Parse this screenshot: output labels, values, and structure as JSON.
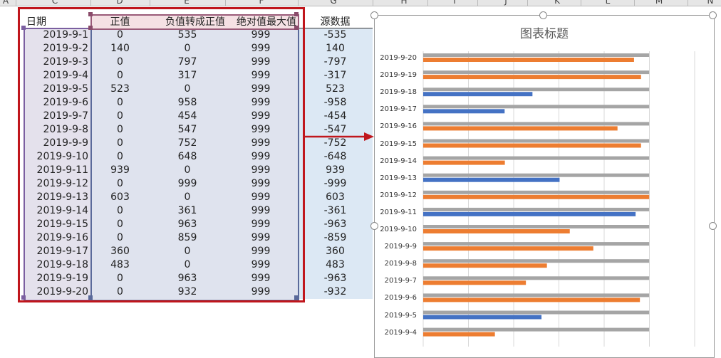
{
  "columns": [
    "A",
    "C",
    "D",
    "E",
    "F",
    "G",
    "H",
    "I",
    "J",
    "K",
    "L",
    "M",
    "N"
  ],
  "headers": {
    "date": "日期",
    "pos": "正值",
    "neg": "负值转成正值",
    "max": "绝对值最大值",
    "src": "源数据"
  },
  "rows": [
    [
      "2019-9-1",
      "0",
      "535",
      "999",
      "-535"
    ],
    [
      "2019-9-2",
      "140",
      "0",
      "999",
      "140"
    ],
    [
      "2019-9-3",
      "0",
      "797",
      "999",
      "-797"
    ],
    [
      "2019-9-4",
      "0",
      "317",
      "999",
      "-317"
    ],
    [
      "2019-9-5",
      "523",
      "0",
      "999",
      "523"
    ],
    [
      "2019-9-6",
      "0",
      "958",
      "999",
      "-958"
    ],
    [
      "2019-9-7",
      "0",
      "454",
      "999",
      "-454"
    ],
    [
      "2019-9-8",
      "0",
      "547",
      "999",
      "-547"
    ],
    [
      "2019-9-9",
      "0",
      "752",
      "999",
      "-752"
    ],
    [
      "2019-9-10",
      "0",
      "648",
      "999",
      "-648"
    ],
    [
      "2019-9-11",
      "939",
      "0",
      "999",
      "939"
    ],
    [
      "2019-9-12",
      "0",
      "999",
      "999",
      "-999"
    ],
    [
      "2019-9-13",
      "603",
      "0",
      "999",
      "603"
    ],
    [
      "2019-9-14",
      "0",
      "361",
      "999",
      "-361"
    ],
    [
      "2019-9-15",
      "0",
      "963",
      "999",
      "-963"
    ],
    [
      "2019-9-16",
      "0",
      "859",
      "999",
      "-859"
    ],
    [
      "2019-9-17",
      "360",
      "0",
      "999",
      "360"
    ],
    [
      "2019-9-18",
      "483",
      "0",
      "999",
      "483"
    ],
    [
      "2019-9-19",
      "0",
      "963",
      "999",
      "-963"
    ],
    [
      "2019-9-20",
      "0",
      "932",
      "999",
      "-932"
    ]
  ],
  "chart_data": {
    "type": "bar",
    "orientation": "horizontal",
    "title": "图表标题",
    "categories": [
      "2019-9-20",
      "2019-9-19",
      "2019-9-18",
      "2019-9-17",
      "2019-9-16",
      "2019-9-15",
      "2019-9-14",
      "2019-9-13",
      "2019-9-12",
      "2019-9-11",
      "2019-9-10",
      "2019-9-9",
      "2019-9-8",
      "2019-9-7",
      "2019-9-6",
      "2019-9-5",
      "2019-9-4"
    ],
    "series": [
      {
        "name": "绝对值最大值",
        "color": "#a5a5a5",
        "values": [
          999,
          999,
          999,
          999,
          999,
          999,
          999,
          999,
          999,
          999,
          999,
          999,
          999,
          999,
          999,
          999,
          999
        ]
      },
      {
        "name": "正值",
        "color": "#4472c4",
        "values": [
          0,
          0,
          483,
          360,
          0,
          0,
          0,
          603,
          0,
          939,
          0,
          0,
          0,
          0,
          0,
          523,
          0
        ]
      },
      {
        "name": "负值转成正值",
        "color": "#ed7d31",
        "values": [
          932,
          963,
          0,
          0,
          859,
          963,
          361,
          0,
          999,
          0,
          648,
          752,
          547,
          454,
          958,
          0,
          317
        ]
      }
    ],
    "xlim": [
      0,
      1200
    ],
    "grid": true
  }
}
